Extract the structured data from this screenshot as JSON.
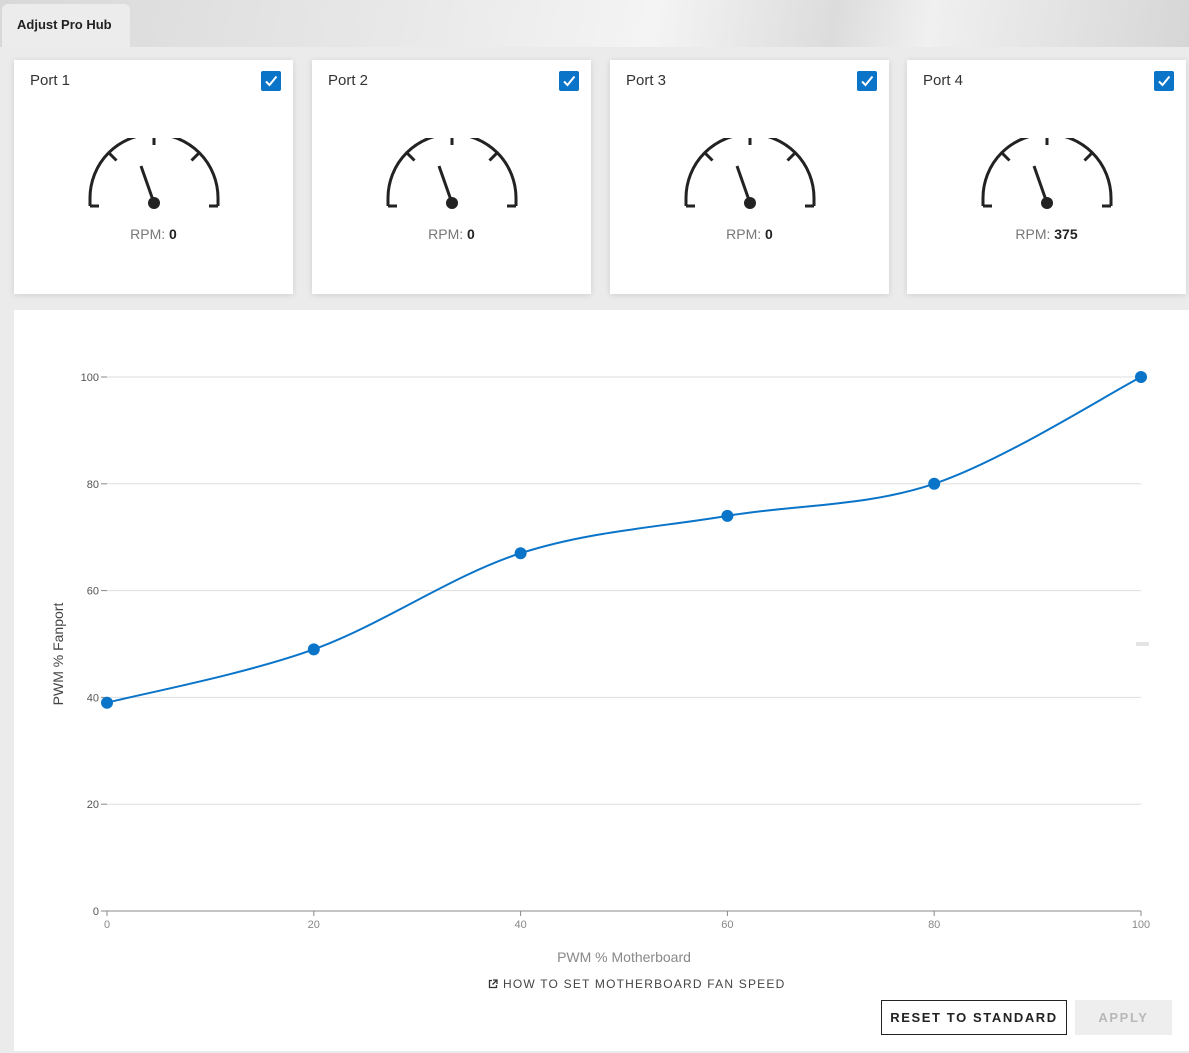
{
  "app": {
    "tab_title": "Adjust Pro Hub"
  },
  "ports": [
    {
      "label": "Port 1",
      "checked": true,
      "rpm_label": "RPM:",
      "rpm": "0"
    },
    {
      "label": "Port 2",
      "checked": true,
      "rpm_label": "RPM:",
      "rpm": "0"
    },
    {
      "label": "Port 3",
      "checked": true,
      "rpm_label": "RPM:",
      "rpm": "0"
    },
    {
      "label": "Port 4",
      "checked": true,
      "rpm_label": "RPM:",
      "rpm": "375"
    }
  ],
  "chart_data": {
    "type": "line",
    "xlabel": "PWM % Motherboard",
    "ylabel": "PWM % Fanport",
    "xlim": [
      0,
      100
    ],
    "ylim": [
      0,
      100
    ],
    "x_ticks": [
      "0",
      "20",
      "40",
      "60",
      "80",
      "100"
    ],
    "y_ticks": [
      "0",
      "20",
      "40",
      "60",
      "80",
      "100"
    ],
    "grid": true,
    "smooth": true,
    "series": [
      {
        "x": [
          0,
          20,
          40,
          60,
          80,
          100
        ],
        "y": [
          39,
          49,
          67,
          74,
          80,
          100
        ]
      }
    ],
    "color": "#0a74c9"
  },
  "help_link": {
    "icon": "external-link-icon",
    "label": "HOW TO SET MOTHERBOARD FAN SPEED"
  },
  "buttons": {
    "reset": "RESET TO STANDARD",
    "apply": "APPLY"
  }
}
